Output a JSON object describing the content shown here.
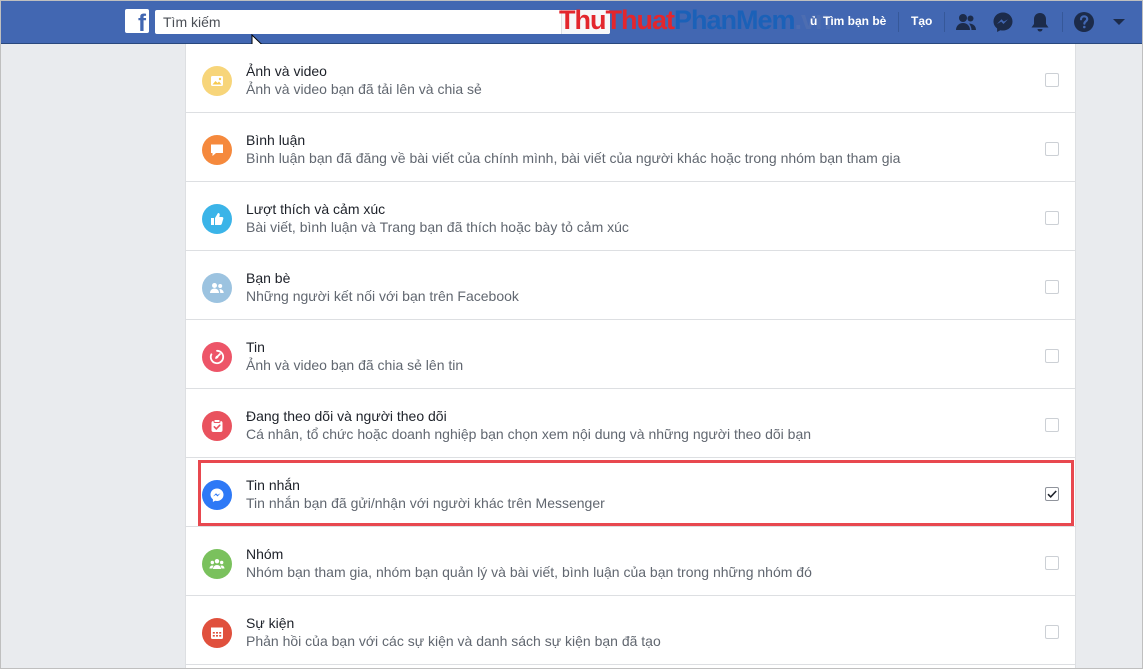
{
  "header": {
    "logo_letter": "f",
    "search_placeholder": "Tìm kiếm",
    "watermark": {
      "part1": "Thu",
      "part2": "Thuat",
      "part3": "Phan",
      "part4": "Mem",
      "part5": ".vn"
    },
    "links": {
      "partial": "ủ",
      "find_friends": "Tìm bạn bè",
      "create": "Tạo"
    },
    "icons": [
      "friend-requests-icon",
      "messenger-icon",
      "notifications-icon",
      "help-icon",
      "account-menu-icon"
    ]
  },
  "rows": [
    {
      "title": "Ảnh và video",
      "desc": "Ảnh và video bạn đã tải lên và chia sẻ",
      "icon": "photos-icon",
      "color": "#f7c94d",
      "checked": false
    },
    {
      "title": "Bình luận",
      "desc": "Bình luận bạn đã đăng về bài viết của chính mình, bài viết của người khác hoặc trong nhóm bạn tham gia",
      "icon": "comment-icon",
      "color": "#f5893d",
      "checked": false
    },
    {
      "title": "Lượt thích và cảm xúc",
      "desc": "Bài viết, bình luận và Trang bạn đã thích hoặc bày tỏ cảm xúc",
      "icon": "like-icon",
      "color": "#3bb4e8",
      "checked": false
    },
    {
      "title": "Bạn bè",
      "desc": "Những người kết nối với bạn trên Facebook",
      "icon": "friends-icon",
      "color": "#9cc3e0",
      "checked": false
    },
    {
      "title": "Tin",
      "desc": "Ảnh và video bạn đã chia sẻ lên tin",
      "icon": "stories-icon",
      "color": "#ed5568",
      "checked": false
    },
    {
      "title": "Đang theo dõi và người theo dõi",
      "desc": "Cá nhân, tổ chức hoặc doanh nghiệp bạn chọn xem nội dung và những người theo dõi bạn",
      "icon": "following-icon",
      "color": "#e9525e",
      "checked": false
    },
    {
      "title": "Tin nhắn",
      "desc": "Tin nhắn bạn đã gửi/nhận với người khác trên Messenger",
      "icon": "messenger-icon",
      "color": "#2e79f6",
      "checked": true
    },
    {
      "title": "Nhóm",
      "desc": "Nhóm bạn tham gia, nhóm bạn quản lý và bài viết, bình luận của bạn trong những nhóm đó",
      "icon": "groups-icon",
      "color": "#7ac15d",
      "checked": false
    },
    {
      "title": "Sự kiện",
      "desc": "Phản hồi của bạn với các sự kiện và danh sách sự kiện bạn đã tạo",
      "icon": "events-icon",
      "color": "#e0503d",
      "checked": false
    }
  ]
}
